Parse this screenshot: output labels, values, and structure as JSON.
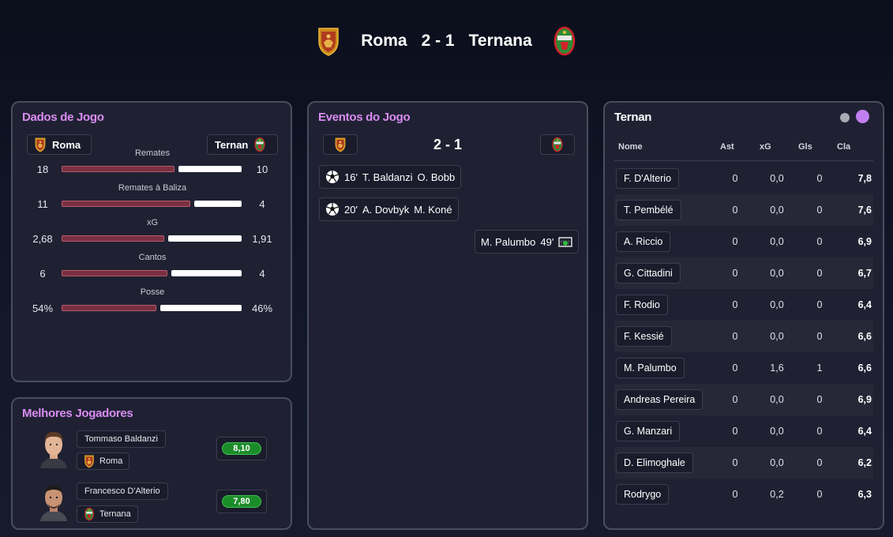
{
  "match": {
    "home_team": "Roma",
    "away_team": "Ternana",
    "score": "2 - 1"
  },
  "colors": {
    "accent_title": "#d98cf0",
    "panel_bg": "#1f2133",
    "home_bar": "#7a3040",
    "away_bar": "#ffffff",
    "rating_green": "#1c8c2a"
  },
  "stats_panel": {
    "title": "Dados de Jogo",
    "home_chip": "Roma",
    "away_chip": "Ternan",
    "stats": [
      {
        "label": "Remates",
        "home": "18",
        "away": "10",
        "home_share": 0.643
      },
      {
        "label": "Remates à Baliza",
        "home": "11",
        "away": "4",
        "home_share": 0.733
      },
      {
        "label": "xG",
        "home": "2,68",
        "away": "1,91",
        "home_share": 0.584
      },
      {
        "label": "Cantos",
        "home": "6",
        "away": "4",
        "home_share": 0.6
      },
      {
        "label": "Posse",
        "home": "54%",
        "away": "46%",
        "home_share": 0.54
      }
    ]
  },
  "best_players": {
    "title": "Melhores Jogadores",
    "players": [
      {
        "name": "Tommaso Baldanzi",
        "team": "Roma",
        "rating": "8,10"
      },
      {
        "name": "Francesco D'Alterio",
        "team": "Ternana",
        "rating": "7,80"
      }
    ]
  },
  "events_panel": {
    "title": "Eventos do Jogo",
    "score": "2 - 1",
    "events": [
      {
        "side": "home",
        "minute": "16'",
        "scorer": "T. Baldanzi",
        "assist": "O. Bobb",
        "icon": "soccer-ball-icon"
      },
      {
        "side": "home",
        "minute": "20'",
        "scorer": "A. Dovbyk",
        "assist": "M. Koné",
        "icon": "soccer-ball-icon"
      },
      {
        "side": "away",
        "minute": "49'",
        "scorer": "M. Palumbo",
        "icon": "goal-net-icon"
      }
    ]
  },
  "lineup_panel": {
    "title": "Ternan",
    "columns": {
      "name": "Nome",
      "ast": "Ast",
      "xg": "xG",
      "gls": "Gls",
      "cla": "Cla"
    },
    "rows": [
      {
        "name": "F. D'Alterio",
        "ast": "0",
        "xg": "0,0",
        "gls": "0",
        "cla": "7,8"
      },
      {
        "name": "T. Pembélé",
        "ast": "0",
        "xg": "0,0",
        "gls": "0",
        "cla": "7,6"
      },
      {
        "name": "A. Riccio",
        "ast": "0",
        "xg": "0,0",
        "gls": "0",
        "cla": "6,9"
      },
      {
        "name": "G. Cittadini",
        "ast": "0",
        "xg": "0,0",
        "gls": "0",
        "cla": "6,7"
      },
      {
        "name": "F. Rodio",
        "ast": "0",
        "xg": "0,0",
        "gls": "0",
        "cla": "6,4"
      },
      {
        "name": "F. Kessié",
        "ast": "0",
        "xg": "0,0",
        "gls": "0",
        "cla": "6,6"
      },
      {
        "name": "M. Palumbo",
        "ast": "0",
        "xg": "1,6",
        "gls": "1",
        "cla": "6,6"
      },
      {
        "name": "Andreas Pereira",
        "ast": "0",
        "xg": "0,0",
        "gls": "0",
        "cla": "6,9"
      },
      {
        "name": "G. Manzari",
        "ast": "0",
        "xg": "0,0",
        "gls": "0",
        "cla": "6,4"
      },
      {
        "name": "D. Elimoghale",
        "ast": "0",
        "xg": "0,0",
        "gls": "0",
        "cla": "6,2"
      },
      {
        "name": "Rodrygo",
        "ast": "0",
        "xg": "0,2",
        "gls": "0",
        "cla": "6,3"
      }
    ]
  }
}
